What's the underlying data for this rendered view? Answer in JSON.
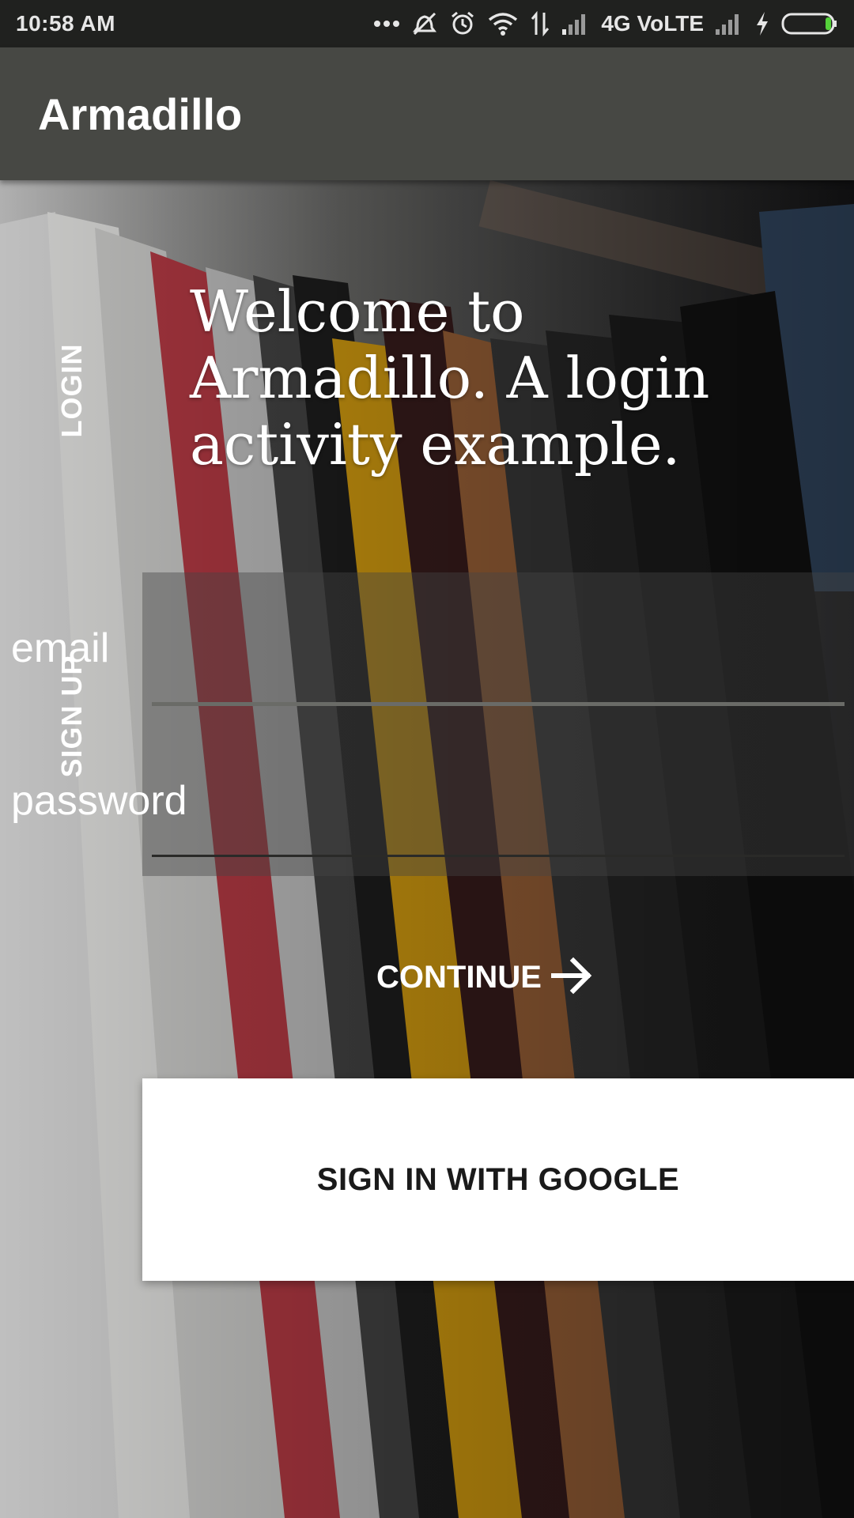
{
  "status_bar": {
    "time": "10:58 AM",
    "network_label": "4G VoLTE",
    "icons": [
      "more-dots-icon",
      "vibrate-off-icon",
      "alarm-icon",
      "wifi-icon",
      "data-transfer-icon",
      "signal-icon",
      "signal-2-icon",
      "charging-icon",
      "battery-icon"
    ]
  },
  "app_bar": {
    "title": "Armadillo"
  },
  "tabs": {
    "login": "LOGIN",
    "signup": "SIGN UP"
  },
  "welcome": {
    "line1": "Welcome to",
    "line2": "Armadillo. A login",
    "line3": "activity example."
  },
  "form": {
    "email_placeholder": "email",
    "email_value": "",
    "password_placeholder": "password",
    "password_value": ""
  },
  "continue_button": {
    "label": "CONTINUE",
    "icon": "arrow-right-icon"
  },
  "google_button": {
    "label": "SIGN IN WITH GOOGLE"
  },
  "colors": {
    "status_bar": "#20211f",
    "app_bar": "#474844",
    "text_primary": "#ffffff",
    "google_button_bg": "#ffffff",
    "battery_level": "#55d23a"
  }
}
